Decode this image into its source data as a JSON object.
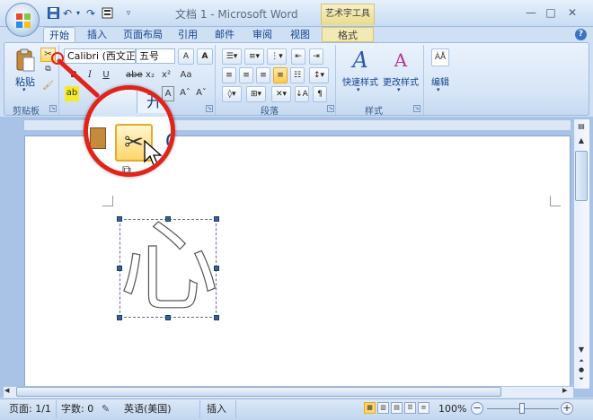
{
  "titlebar": {
    "title": "文档 1 - Microsoft Word",
    "context_tool": "艺术字工具"
  },
  "tabs": [
    {
      "label": "开始",
      "active": true
    },
    {
      "label": "插入"
    },
    {
      "label": "页面布局"
    },
    {
      "label": "引用"
    },
    {
      "label": "邮件"
    },
    {
      "label": "审阅"
    },
    {
      "label": "视图"
    },
    {
      "label": "格式"
    }
  ],
  "ribbon": {
    "clipboard": {
      "paste_label": "粘贴",
      "group_label": "剪贴板"
    },
    "font": {
      "font_name": "Calibri (西文正",
      "font_size": "五号",
      "group_label": "字体"
    },
    "paragraph": {
      "group_label": "段落"
    },
    "styles": {
      "quick_styles": "快速样式",
      "change_styles": "更改样式",
      "group_label": "样式"
    },
    "editing": {
      "label": "编辑"
    }
  },
  "document": {
    "wordart_text": "心"
  },
  "magnifier": {
    "tab_fragment": "开"
  },
  "statusbar": {
    "page": "页面: 1/1",
    "words": "字数: 0",
    "language": "英语(美国)",
    "mode": "插入",
    "zoom": "100%"
  },
  "colors": {
    "accent_red": "#e2231a",
    "ribbon_blue": "#d6e5f7"
  }
}
